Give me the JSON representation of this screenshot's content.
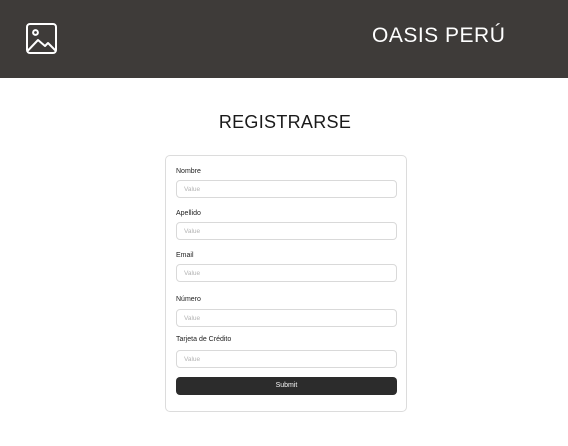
{
  "header": {
    "logo_icon": "image-placeholder-icon",
    "brand": "OASIS PERÚ",
    "background": "#3e3b39"
  },
  "page": {
    "title": "REGISTRARSE"
  },
  "form": {
    "fields": [
      {
        "label": "Nombre",
        "placeholder": "Value",
        "value": ""
      },
      {
        "label": "Apellido",
        "placeholder": "Value",
        "value": ""
      },
      {
        "label": "Email",
        "placeholder": "Value",
        "value": ""
      },
      {
        "label": "Número",
        "placeholder": "Value",
        "value": ""
      },
      {
        "label": "Tarjeta de Crédito",
        "placeholder": "Value",
        "value": ""
      }
    ],
    "submit_label": "Submit",
    "submit_color": "#2c2c2c"
  }
}
